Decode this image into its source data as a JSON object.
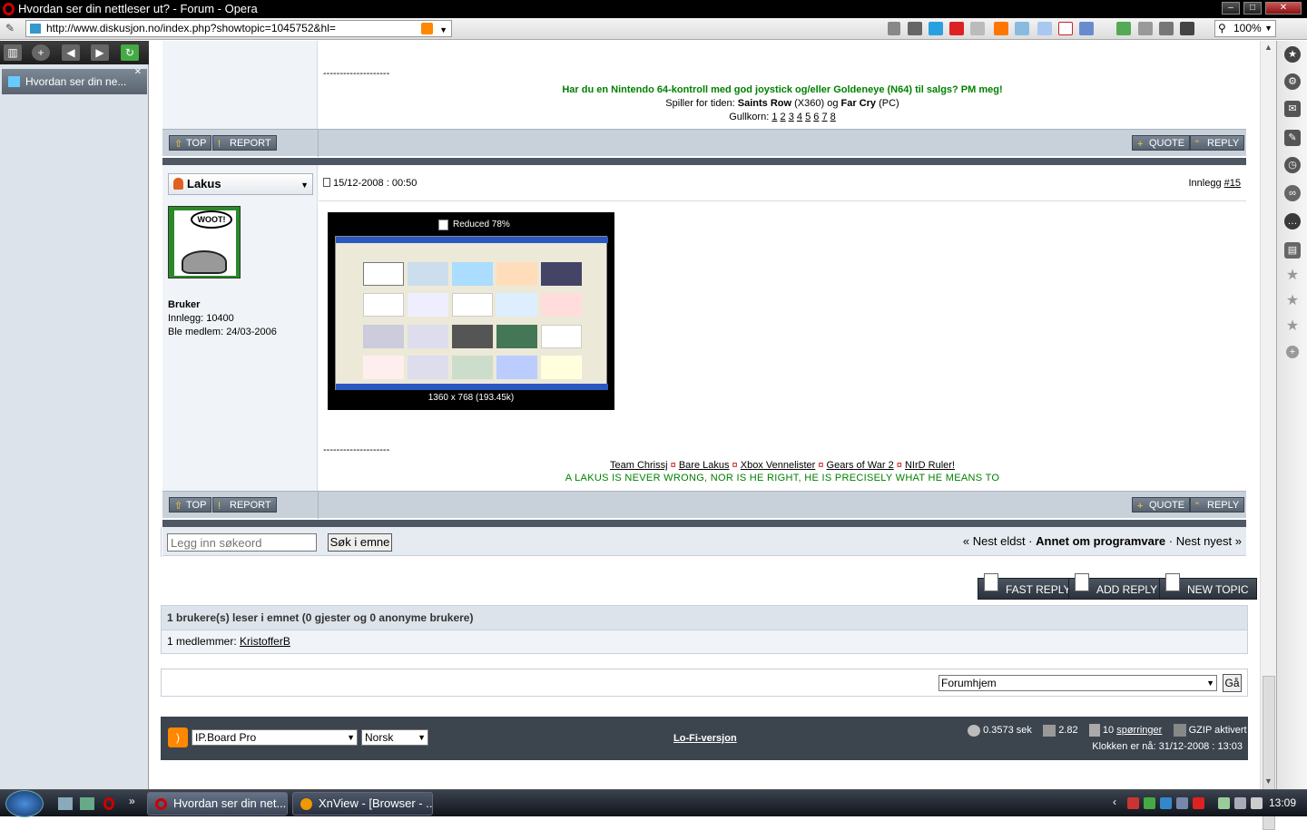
{
  "window": {
    "title": "Hvordan ser din nettleser ut? - Forum - Opera"
  },
  "browser": {
    "url": "http://www.diskusjon.no/index.php?showtopic=1045752&hl=",
    "zoom": "100%",
    "panel_tab": "Hvordan ser din ne..."
  },
  "post_prev": {
    "separator": "--------------------",
    "sig_line1": "Har du en Nintendo 64-kontroll med god joystick og/eller Goldeneye (N64) til salgs? PM meg!",
    "sig_playing_prefix": "Spiller for tiden: ",
    "sig_game1": "Saints Row",
    "sig_plat1": " (X360) og ",
    "sig_game2": "Far Cry",
    "sig_plat2": " (PC)",
    "sig_gull_label": "Gullkorn: ",
    "sig_gull_links": [
      "1",
      "2",
      "3",
      "4",
      "5",
      "6",
      "7",
      "8"
    ]
  },
  "buttons": {
    "top": "TOP",
    "report": "REPORT",
    "quote": "QUOTE",
    "reply": "REPLY"
  },
  "post": {
    "username": "Lakus",
    "avatar_text": "WOOT!",
    "date": "15/12-2008 : 00:50",
    "post_label": "Innlegg ",
    "post_num": "#15",
    "user_group": "Bruker",
    "posts": "Innlegg: 10400",
    "joined": "Ble medlem: 24/03-2006",
    "image_notice": "Reduced 78%",
    "image_size": "1360 x 768 (193.45k)",
    "separator": "--------------------",
    "sig_links": [
      "Team Chrissj",
      "Bare Lakus",
      "Xbox Vennelister",
      "Gears of War 2",
      "NIrD Ruler!"
    ],
    "sig_motto": "A LAKUS IS NEVER WRONG, NOR IS HE RIGHT, HE IS PRECISELY WHAT HE MEANS TO"
  },
  "search": {
    "placeholder": "Legg inn søkeord",
    "button": "Søk i emne"
  },
  "topic_nav": {
    "older": "« Nest eldst",
    "sep1": " · ",
    "forum": "Annet om programvare",
    "sep2": " · ",
    "newer": "Nest nyest »"
  },
  "actions": {
    "fast_reply": "FAST REPLY",
    "add_reply": "ADD REPLY",
    "new_topic": "NEW TOPIC"
  },
  "readers": {
    "title": "1 brukere(s) leser i emnet (0 gjester og 0 anonyme brukere)",
    "members_label": "1 medlemmer: ",
    "member": "KristofferB"
  },
  "jump": {
    "selected": "Forumhjem",
    "go": "Gå"
  },
  "footer": {
    "skin": "IP.Board Pro",
    "language": "Norsk",
    "lofi": "Lo-Fi-versjon",
    "time": "0.3573 sek",
    "load": "2.82",
    "queries_num": "10 ",
    "queries_label": "spørringer",
    "gzip": "GZIP aktivert",
    "clock": "Klokken er nå: 31/12-2008 : 13:03"
  },
  "taskbar": {
    "task1": "Hvordan ser din net...",
    "task2": "XnView - [Browser - ...",
    "clock": "13:09"
  },
  "colors": {
    "sig_green": "#008000",
    "strip": "#4e5864",
    "titlebar": "#000000"
  }
}
